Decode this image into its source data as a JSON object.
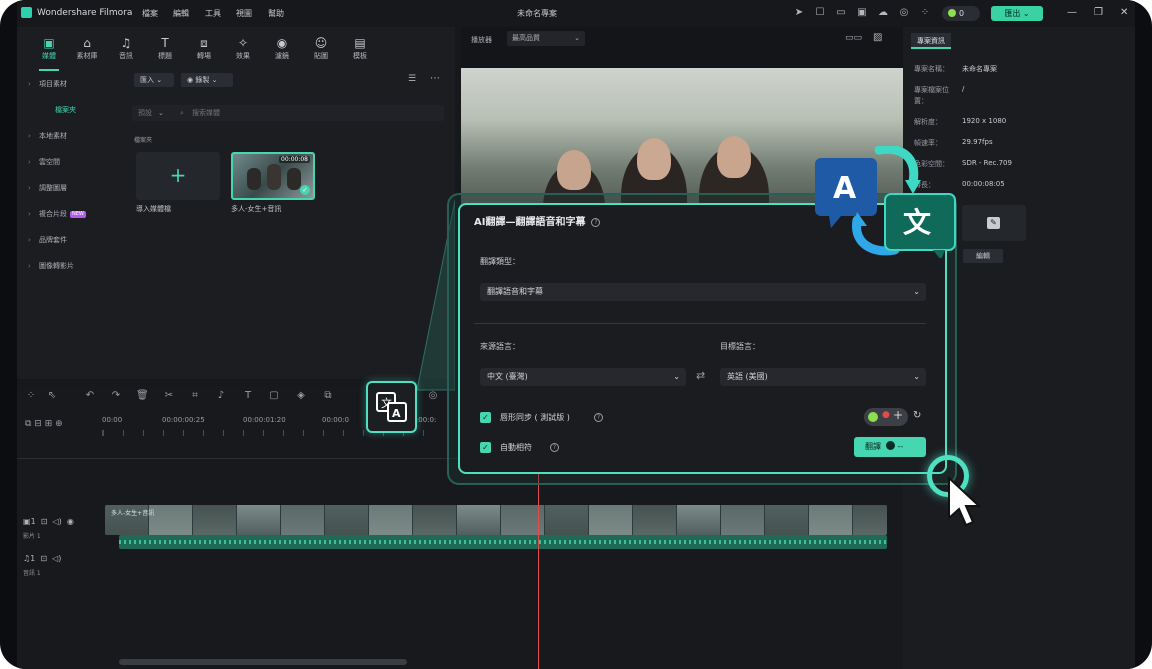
{
  "app": {
    "name": "Wondershare Filmora",
    "menu": [
      "檔案",
      "編輯",
      "工具",
      "視圖",
      "幫助"
    ],
    "project_title": "未命名專案",
    "credits": "0",
    "export_label": "匯出"
  },
  "media_panel": {
    "tabs": [
      {
        "label": "媒體",
        "icon": "media-icon"
      },
      {
        "label": "素材庫",
        "icon": "stock-icon"
      },
      {
        "label": "音訊",
        "icon": "audio-icon"
      },
      {
        "label": "標題",
        "icon": "title-icon"
      },
      {
        "label": "轉場",
        "icon": "transition-icon"
      },
      {
        "label": "效果",
        "icon": "effects-icon"
      },
      {
        "label": "濾鏡",
        "icon": "filter-icon"
      },
      {
        "label": "貼圖",
        "icon": "sticker-icon"
      },
      {
        "label": "模板",
        "icon": "template-icon"
      }
    ],
    "sidebar": [
      {
        "label": "項目素材",
        "new": false
      },
      {
        "label": "檔案夾",
        "new": false,
        "selected": true
      },
      {
        "label": "本地素材",
        "new": false
      },
      {
        "label": "雲空間",
        "new": false
      },
      {
        "label": "調整圖層",
        "new": false
      },
      {
        "label": "複合片段",
        "new": true
      },
      {
        "label": "品牌套件",
        "new": false
      },
      {
        "label": "圖像轉影片",
        "new": false
      }
    ],
    "new_badge": "NEW",
    "import_label": "匯入",
    "record_label": "錄製",
    "default_label": "預設",
    "search_placeholder": "搜索媒體",
    "folder_label": "檔案夾",
    "import_tile_label": "導入媒體檔",
    "clip_label": "多人-女生+音訊",
    "clip_duration": "00:00:08"
  },
  "player": {
    "label": "播放器",
    "quality": "最高品質"
  },
  "project_info": {
    "tab": "專案資訊",
    "rows": [
      {
        "label": "專案名稱：",
        "value": "未命名專案"
      },
      {
        "label": "專案檔案位置：",
        "value": "/"
      },
      {
        "label": "解析度：",
        "value": "1920 x 1080"
      },
      {
        "label": "幀速率：",
        "value": "29.97fps"
      },
      {
        "label": "色彩空間：",
        "value": "SDR - Rec.709"
      },
      {
        "label": "時長：",
        "value": "00:00:08:05"
      }
    ],
    "edit_label": "編輯"
  },
  "timeline": {
    "ruler": [
      "00:00",
      "00:00:00:25",
      "00:00:01:20",
      "00:00:0"
    ],
    "ruler_end": "00:00:0:",
    "video_track": "影片 1",
    "audio_track": "音訊 1",
    "track_number": "1",
    "clip_name": "多人-女生+音訊"
  },
  "dialog": {
    "title": "AI翻譯—翻譯語音和字幕",
    "type_label": "翻譯類型：",
    "type_value": "翻譯語音和字幕",
    "source_label": "來源語言：",
    "source_value": "中文 (臺灣)",
    "target_label": "目標語言：",
    "target_value": "英語 (美國)",
    "lipsync_label": "唇形同步 ( 測試版 )",
    "autofit_label": "自動相符",
    "translate_button": "翻譯",
    "translate_cost": "--"
  },
  "colors": {
    "accent": "#46d6b2",
    "dialog_border": "#4ee0c0",
    "playhead": "#e24b4b",
    "credit_dot": "#8ddf4e",
    "new_badge": "#b45cf0"
  }
}
